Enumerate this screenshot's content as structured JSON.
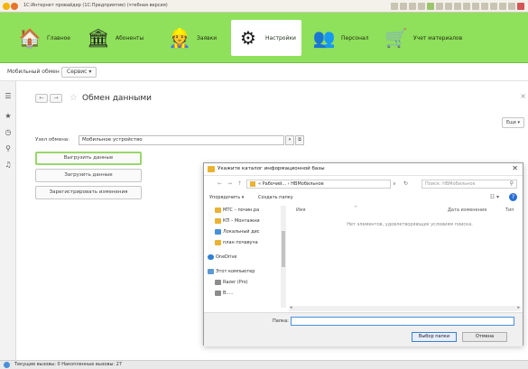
{
  "window": {
    "title": "1С:Интернет провайдер (1С:Предприятие) (чтебная версия)"
  },
  "sections": [
    {
      "label": "Главное",
      "icon": "home-icon",
      "glyph": "🏠"
    },
    {
      "label": "Абоненты",
      "icon": "columns-icon",
      "glyph": "🏛"
    },
    {
      "label": "Заявки",
      "icon": "workers-icon",
      "glyph": "👷"
    },
    {
      "label": "Настройки",
      "icon": "gear-icon",
      "glyph": "⚙",
      "active": true
    },
    {
      "label": "Персонал",
      "icon": "staff-icon",
      "glyph": "👥"
    },
    {
      "label": "Учет материалов",
      "icon": "cart-icon",
      "glyph": "🛒"
    }
  ],
  "funcbar": {
    "mobile_label": "Мобильный обмен",
    "service_label": "Сервис ▾"
  },
  "form": {
    "title": "Обмен данными",
    "more_label": "Еще ▾",
    "node_label": "Узел обмена:",
    "node_value": "Мобильное устройство",
    "actions": [
      "Выгрузить данные",
      "Загрузить данные",
      "Зарегистрировать изменения"
    ]
  },
  "dialog": {
    "title": "Укажите каталог информационной базы",
    "address": "« Рабочий... › НВМобильное",
    "search_placeholder": "Поиск: НВМобильное",
    "organize_label": "Упорядочить ▾",
    "new_folder_label": "Создать папку",
    "nav_items": [
      {
        "label": "МТС – почин.ра",
        "kind": "folder"
      },
      {
        "label": "КП – Монтажни",
        "kind": "folder"
      },
      {
        "label": "Локальный дис",
        "kind": "drive"
      },
      {
        "label": "план почавуча",
        "kind": "folder"
      },
      {
        "label": "OneDrive",
        "kind": "cloud"
      },
      {
        "label": "Этот компьютер",
        "kind": "pc"
      },
      {
        "label": "Razer (Pro)",
        "kind": "drive"
      },
      {
        "label": "В.....",
        "kind": "drive"
      }
    ],
    "columns": [
      "Имя",
      "Дата изменения",
      "Тип"
    ],
    "empty_text": "Нет элементов, удовлетворяющих условиям поиска.",
    "folder_label": "Папка:",
    "folder_value": "",
    "select_label": "Выбор папки",
    "cancel_label": "Отмена"
  },
  "status": {
    "text": "Текущие вызовы: 0   Накопленные вызовы: 27"
  }
}
